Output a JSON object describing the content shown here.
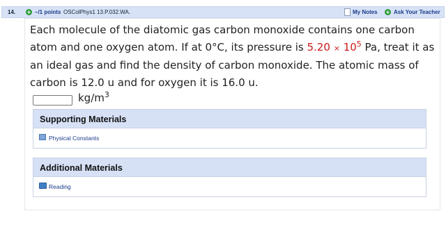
{
  "header": {
    "question_number": "14.",
    "points": "–/1 points",
    "source": "OSColPhys1 13.P.032.WA.",
    "my_notes": "My Notes",
    "ask_teacher": "Ask Your Teacher"
  },
  "question": {
    "text_part1": "Each molecule of the diatomic gas carbon monoxide contains one carbon atom and one oxygen atom. If at 0°C, its pressure is ",
    "mantissa": "5.20",
    "times": "×",
    "base": "10",
    "exponent": "5",
    "text_part2": " Pa, treat it as an ideal gas and find the density of carbon monoxide. The atomic mass of carbon is 12.0 u and for oxygen it is 16.0 u."
  },
  "answer": {
    "value": "",
    "unit": "kg/m",
    "unit_exponent": "3"
  },
  "supporting": {
    "title": "Supporting Materials",
    "link": "Physical Constants"
  },
  "additional": {
    "title": "Additional Materials",
    "link": "Reading"
  },
  "colors": {
    "header_bg": "#d7e2f6",
    "link": "#1a3c8a",
    "highlight_red": "#cc1a1a",
    "icon_green": "#2e9b3b"
  }
}
